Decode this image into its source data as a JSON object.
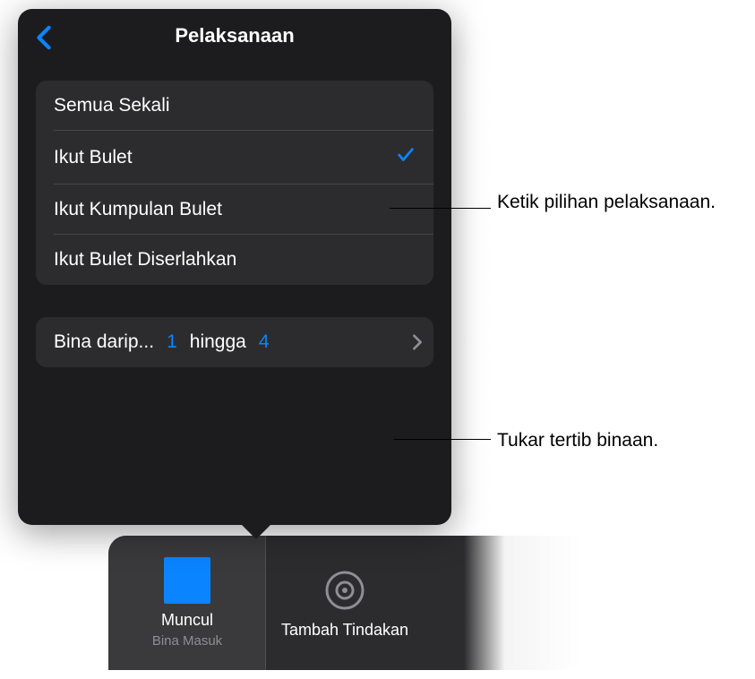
{
  "popover": {
    "title": "Pelaksanaan",
    "options": [
      {
        "label": "Semua Sekali",
        "selected": false
      },
      {
        "label": "Ikut Bulet",
        "selected": true
      },
      {
        "label": "Ikut Kumpulan Bulet",
        "selected": false
      },
      {
        "label": "Ikut Bulet Diserlahkan",
        "selected": false
      }
    ],
    "buildRow": {
      "label": "Bina darip...",
      "from": "1",
      "toWord": "hingga",
      "to": "4"
    }
  },
  "effectBar": {
    "selectedTitle": "Muncul",
    "selectedSubtitle": "Bina Masuk",
    "addActionLabel": "Tambah Tindakan"
  },
  "annotations": {
    "optionNote": "Ketik pilihan pelaksanaan.",
    "buildNote": "Tukar tertib binaan."
  }
}
